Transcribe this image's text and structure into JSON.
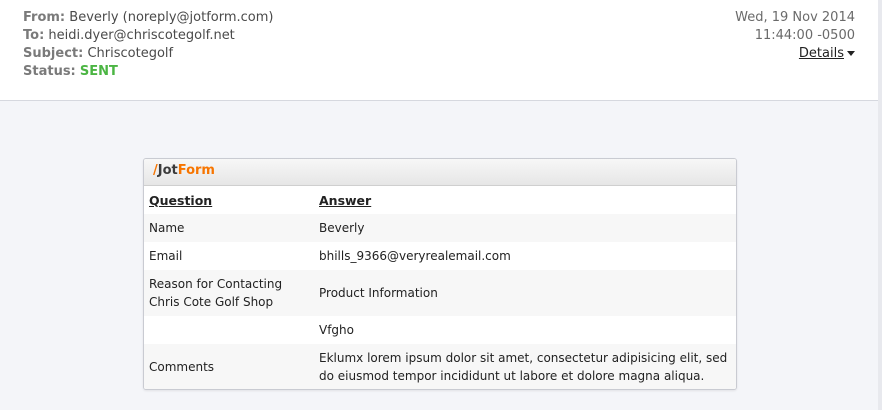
{
  "email": {
    "from_label": "From:",
    "from_value": "Beverly (noreply@jotform.com)",
    "to_label": "To:",
    "to_value": "heidi.dyer@chriscotegolf.net",
    "subject_label": "Subject:",
    "subject_value": "Chriscotegolf",
    "status_label": "Status:",
    "status_value": "SENT",
    "date": "Wed, 19 Nov 2014",
    "time": "11:44:00 -0500",
    "details_label": "Details"
  },
  "card": {
    "logo_jot": "Jot",
    "logo_form": "Form",
    "headers": {
      "question": "Question",
      "answer": "Answer"
    },
    "rows": [
      {
        "question": "Name",
        "answer": "Beverly"
      },
      {
        "question": "Email",
        "answer": "bhills_9366@veryrealemail.com"
      },
      {
        "question": "Reason for Contacting Chris Cote Golf Shop",
        "answer": "Product Information"
      },
      {
        "question": "",
        "answer": "Vfgho"
      },
      {
        "question": "Comments",
        "answer": "Eklumx lorem ipsum dolor sit amet, consectetur adipisicing elit, sed do eiusmod tempor incididunt ut labore et dolore magna aliqua."
      }
    ]
  },
  "colors": {
    "status_sent": "#4bb543",
    "brand_orange": "#f77500"
  }
}
